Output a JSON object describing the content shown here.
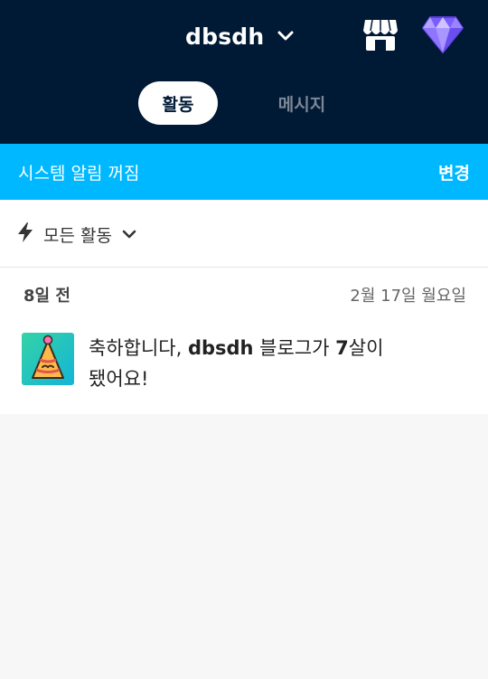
{
  "header": {
    "blog_name": "dbsdh",
    "icons": {
      "switcher": "chevron-down-icon",
      "store": "storefront-icon",
      "premium": "diamond-icon"
    },
    "tabs": [
      {
        "label": "활동",
        "active": true
      },
      {
        "label": "메시지",
        "active": false
      }
    ]
  },
  "banner": {
    "text": "시스템 알림 꺼짐",
    "action": "변경",
    "color": "#00b8ff"
  },
  "filter": {
    "label": "모든 활동",
    "icon": "lightning-icon"
  },
  "feed": {
    "day_ago": "8일 전",
    "date": "2월 17일 월요일",
    "notification": {
      "avatar_icon": "party-hat-icon",
      "prefix": "축하합니다, ",
      "blog": "dbsdh",
      "middle": " 블로그가 ",
      "years": "7",
      "suffix_1": "살이",
      "suffix_2": "됐어요!"
    }
  },
  "colors": {
    "header_bg": "#001935",
    "accent": "#00b8ff",
    "page_bg": "#f7f7f7"
  }
}
